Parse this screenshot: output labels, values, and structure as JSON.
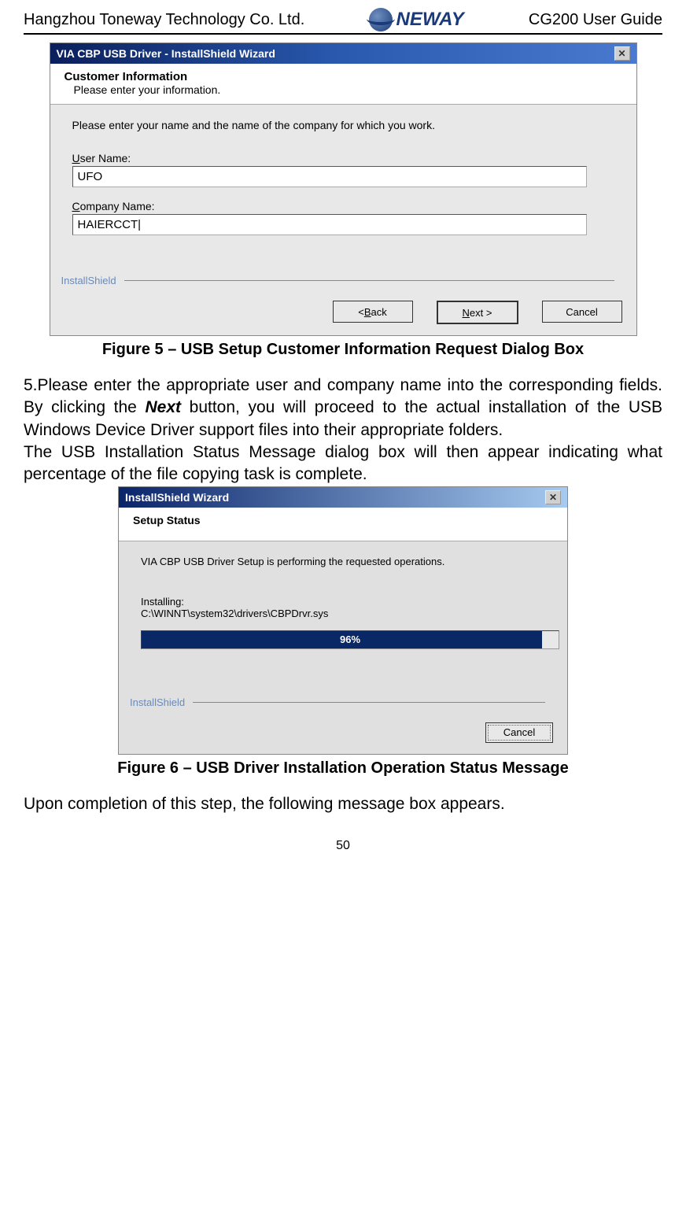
{
  "header": {
    "company": "Hangzhou Toneway Technology Co. Ltd.",
    "logo_text": "NEWAY",
    "doc_title": "CG200 User Guide"
  },
  "dialog1": {
    "titlebar": "VIA CBP USB Driver - InstallShield Wizard",
    "close_glyph": "✕",
    "header_title": "Customer Information",
    "header_subtitle": "Please enter your information.",
    "instruction": "Please enter your name and the name of the company for which you work.",
    "user_name_prefix": "U",
    "user_name_rest": "ser Name:",
    "user_name_value": "UFO",
    "company_name_prefix": "C",
    "company_name_rest": "ompany Name:",
    "company_name_value": "HAIERCCT",
    "install_shield": "InstallShield",
    "buttons": {
      "back_lt": "< ",
      "back_u": "B",
      "back_rest": "ack",
      "next_u": "N",
      "next_rest": "ext >",
      "cancel": "Cancel"
    }
  },
  "figure5_caption": "Figure 5 – USB Setup Customer Information Request Dialog Box",
  "body1_pre": "5.Please enter the appropriate user and company name into the corresponding fields. By clicking the ",
  "body1_next": "Next",
  "body1_post": " button, you will proceed to the actual installation of the USB Windows Device Driver support files into their appropriate folders.",
  "body2": "The USB Installation Status Message dialog box will then appear indicating what percentage of the file copying task is complete.",
  "dialog2": {
    "titlebar": "InstallShield Wizard",
    "close_glyph": "✕",
    "header_title": "Setup Status",
    "status_line": "VIA CBP USB Driver Setup is performing the requested operations.",
    "installing_label": "Installing:",
    "installing_path": "C:\\WINNT\\system32\\drivers\\CBPDrvr.sys",
    "progress_percent": 96,
    "progress_text": "96%",
    "install_shield": "InstallShield",
    "cancel": "Cancel"
  },
  "figure6_caption": "Figure 6 – USB Driver Installation Operation Status Message",
  "body3": "Upon completion of this step, the following message box appears.",
  "page_number": "50"
}
